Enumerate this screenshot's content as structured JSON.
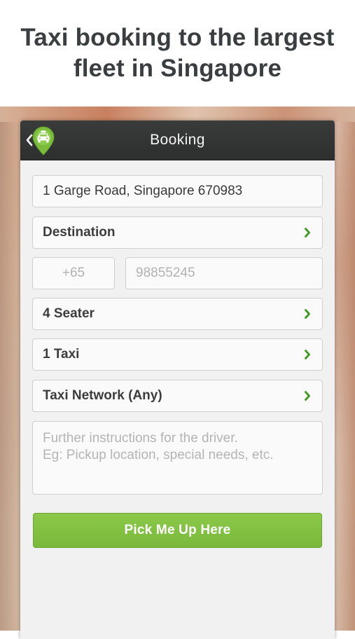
{
  "promo": {
    "headline": "Taxi booking to the largest\nfleet in Singapore"
  },
  "top_bar": {
    "title": "Booking",
    "back_icon": "chevron-left-icon",
    "logo_icon": "taxi-pin-logo"
  },
  "form": {
    "pickup_address": "1 Garge Road, Singapore 670983",
    "destination_label": "Destination",
    "phone": {
      "country_code": "+65",
      "number": "98855245"
    },
    "vehicle_type": "4 Seater",
    "taxi_count": "1 Taxi",
    "taxi_network": "Taxi Network (Any)",
    "instructions_placeholder_line1": "Further instructions for the driver.",
    "instructions_placeholder_line2": "Eg: Pickup location, special needs, etc."
  },
  "submit": {
    "label": "Pick Me Up Here"
  },
  "colors": {
    "accent_green": "#7ABB3C",
    "chevron_green": "#3E9A1F",
    "top_bar": "#323434",
    "headline_text": "#3B3E40"
  }
}
